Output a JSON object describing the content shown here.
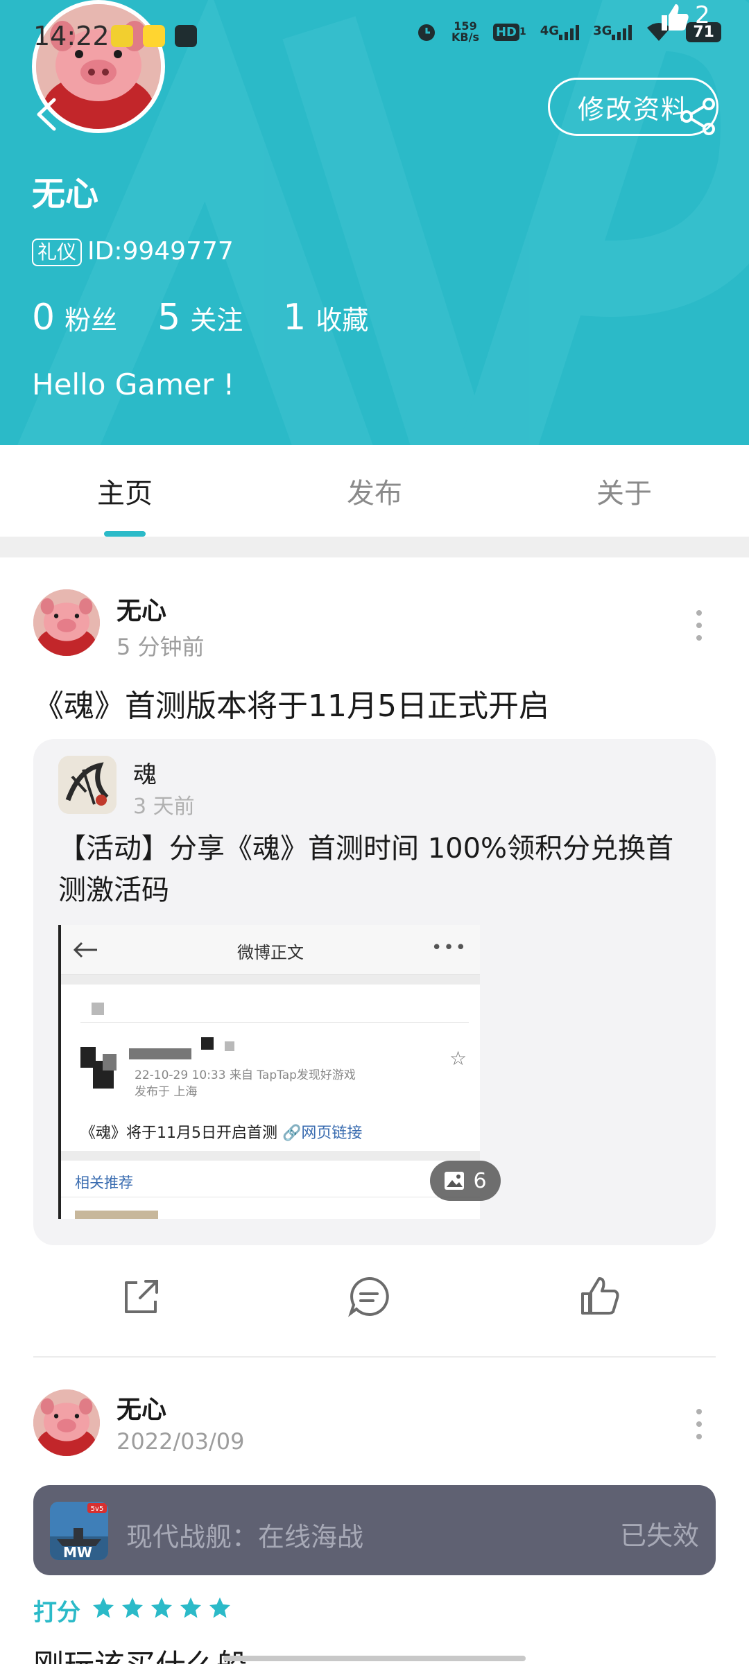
{
  "status_bar": {
    "time": "14:22",
    "net_speed_value": "159",
    "net_speed_unit": "KB/s",
    "hd_label": "HD",
    "hd_sub": "1",
    "net1": "4G",
    "net2": "3G",
    "battery": "71"
  },
  "profile": {
    "like_count": "2",
    "edit_label": "修改资料",
    "name": "无心",
    "badge": "礼仪",
    "id_text": "ID:9949777",
    "stats": [
      {
        "num": "0",
        "label": "粉丝"
      },
      {
        "num": "5",
        "label": "关注"
      },
      {
        "num": "1",
        "label": "收藏"
      }
    ],
    "bio": "Hello Gamer !"
  },
  "tabs": [
    {
      "label": "主页",
      "active": true
    },
    {
      "label": "发布",
      "active": false
    },
    {
      "label": "关于",
      "active": false
    }
  ],
  "post1": {
    "author": "无心",
    "time": "5 分钟前",
    "title": "《魂》首测版本将于11月5日正式开启",
    "shared": {
      "name": "魂",
      "time": "3 天前",
      "text": "【活动】分享《魂》首测时间 100%领积分兑换首测激活码",
      "screenshot": {
        "title": "微博正文",
        "meta1": "22-10-29 10:33 来自 TapTap发现好游戏",
        "meta2": "发布于 上海",
        "line_text": "《魂》将于11月5日开启首测 ",
        "link_text": "🔗网页链接",
        "related": "相关推荐"
      },
      "image_count": "6"
    }
  },
  "post2": {
    "author": "无心",
    "time": "2022/03/09",
    "game_name": "现代战舰：在线海战",
    "game_status": "已失效",
    "game_icon_badge": "5v5",
    "game_icon_text": "MW",
    "rating_label": "打分",
    "rating": 5,
    "rating_max": 5,
    "text": "刚玩该买什么船"
  },
  "colors": {
    "accent": "#2bbac8",
    "game_bar": "#5f6172"
  }
}
